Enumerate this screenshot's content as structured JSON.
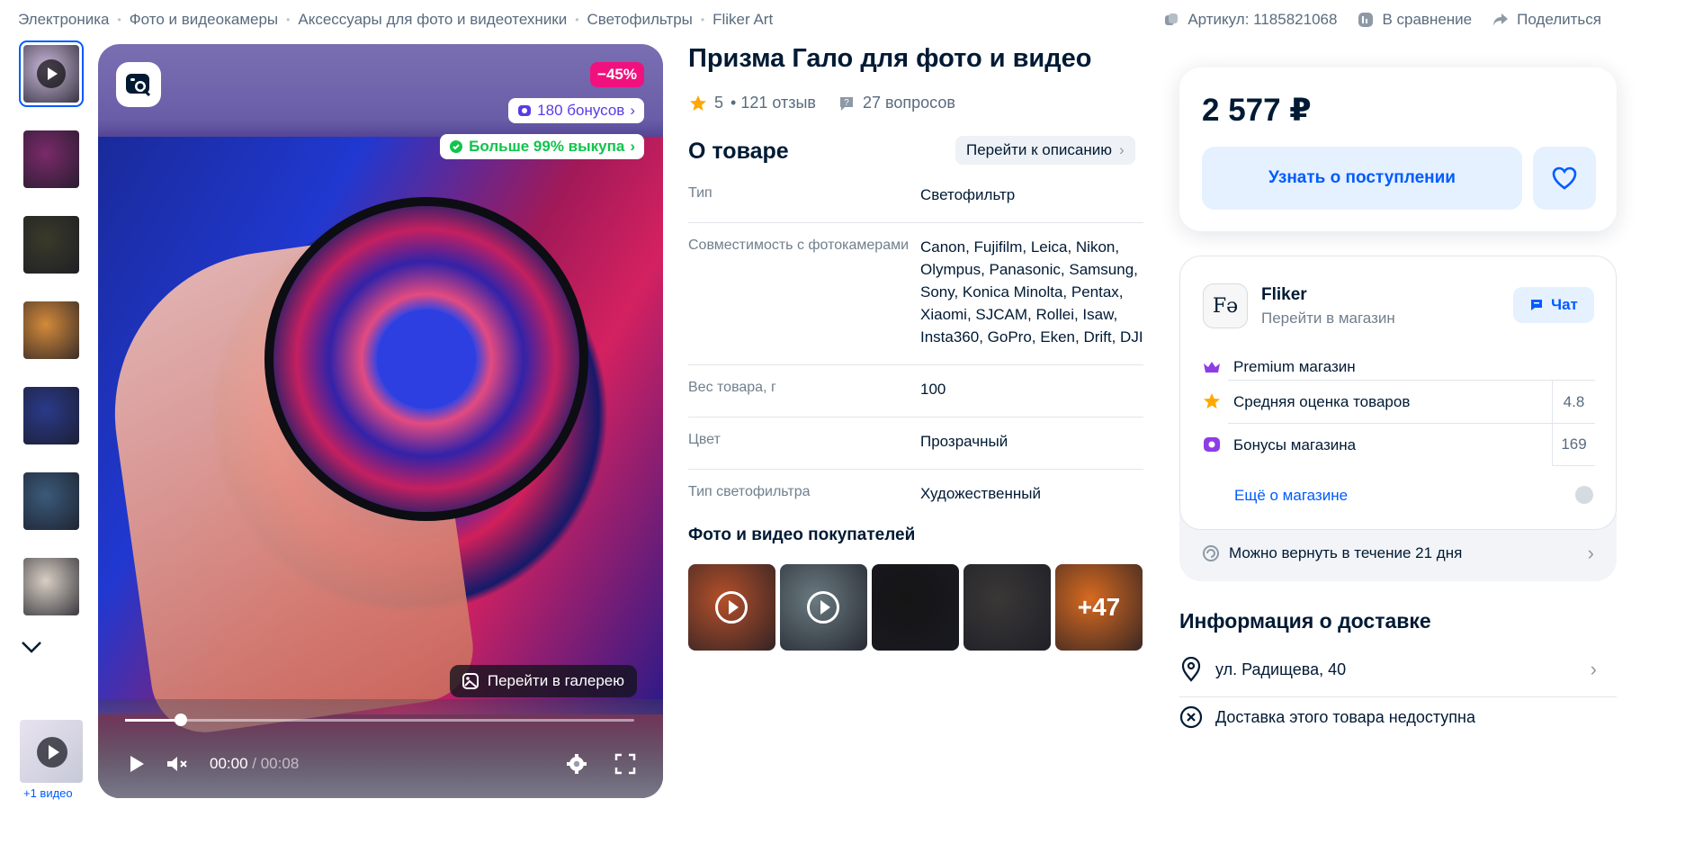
{
  "breadcrumbs": [
    "Электроника",
    "Фото и видеокамеры",
    "Аксессуары для фото и видеотехники",
    "Светофильтры",
    "Fliker Art"
  ],
  "top_actions": {
    "article": "Артикул: 1185821068",
    "compare": "В сравнение",
    "share": "Поделиться"
  },
  "gallery": {
    "more_video": "+1 видео",
    "thumb_colors": [
      "#c9b7d8",
      "#7a2a6a",
      "#3a3a2a",
      "#d48a3a",
      "#2a3a8a",
      "#3a5a7a",
      "#d8cfc4"
    ]
  },
  "media": {
    "discount": "−45%",
    "bonus": "180 бонусов",
    "buyout": "Больше 99% выкупа",
    "gallery_button": "Перейти в галерею",
    "time_current": "00:00",
    "time_total": "/ 00:08",
    "progress": 0.11
  },
  "product": {
    "title": "Призма Гало для фото и видео",
    "rating": "5",
    "reviews": "• 121 отзыв",
    "questions": "27 вопросов"
  },
  "about": {
    "title": "О товаре",
    "to_description": "Перейти к описанию",
    "specs": [
      {
        "key": "Тип",
        "value": "Светофильтр"
      },
      {
        "key": "Совместимость с фотокамерами",
        "value": "Canon, Fujifilm, Leica, Nikon, Olympus, Panasonic, Samsung, Sony, Konica Minolta, Pentax, Xiaomi, SJCAM, Rollei, Isaw, Insta360, GoPro, Eken, Drift, DJI"
      },
      {
        "key": "Вес товара, г",
        "value": "100"
      },
      {
        "key": "Цвет",
        "value": "Прозрачный"
      },
      {
        "key": "Тип светофильтра",
        "value": "Художественный"
      }
    ]
  },
  "buyers": {
    "title": "Фото и видео покупателей",
    "more": "+47",
    "colors": [
      "#b4502a",
      "#6a7a80",
      "#151515",
      "#3a3836",
      "#d86a20"
    ]
  },
  "price_card": {
    "price": "2 577 ₽",
    "notify": "Узнать о поступлении"
  },
  "shop": {
    "logo": "Fə",
    "name": "Fliker",
    "go": "Перейти в магазин",
    "chat": "Чат",
    "premium": "Premium магазин",
    "avg_rating_label": "Средняя оценка товаров",
    "avg_rating": "4.8",
    "bonus_label": "Бонусы магазина",
    "bonus_value": "169",
    "more": "Ещё о магазине",
    "return": "Можно вернуть в течение 21 дня"
  },
  "delivery": {
    "title": "Информация о доставке",
    "address": "ул. Радищева, 40",
    "unavailable": "Доставка этого товара недоступна"
  }
}
